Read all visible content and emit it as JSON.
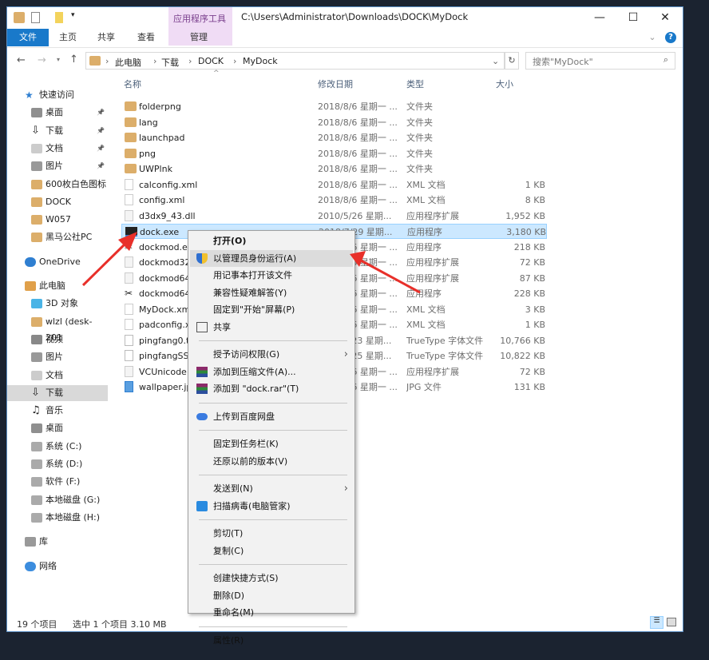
{
  "window": {
    "title": "C:\\Users\\Administrator\\Downloads\\DOCK\\MyDock",
    "context_tab": "应用程序工具",
    "minimize": "—",
    "maximize": "☐",
    "close": "✕"
  },
  "ribbon": {
    "tabs": [
      "文件",
      "主页",
      "共享",
      "查看",
      "管理"
    ],
    "expand": "⌄",
    "help": "?"
  },
  "address": {
    "crumbs": [
      "此电脑",
      "下载",
      "DOCK",
      "MyDock"
    ],
    "search_placeholder": "搜索\"MyDock\"",
    "refresh": "↻"
  },
  "columns": {
    "name": "名称",
    "date": "修改日期",
    "type": "类型",
    "size": "大小"
  },
  "sidebar": [
    {
      "label": "快速访问",
      "icon": "star",
      "indent": 0
    },
    {
      "label": "桌面",
      "icon": "desktop",
      "indent": 1,
      "pin": true
    },
    {
      "label": "下载",
      "icon": "download",
      "indent": 1,
      "pin": true
    },
    {
      "label": "文档",
      "icon": "document",
      "indent": 1,
      "pin": true
    },
    {
      "label": "图片",
      "icon": "pictures",
      "indent": 1,
      "pin": true
    },
    {
      "label": "600枚白色图标",
      "icon": "folder",
      "indent": 1
    },
    {
      "label": "DOCK",
      "icon": "folder",
      "indent": 1
    },
    {
      "label": "W057",
      "icon": "folder",
      "indent": 1
    },
    {
      "label": "黑马公社PC",
      "icon": "folder",
      "indent": 1
    },
    {
      "label": "OneDrive",
      "icon": "cloud",
      "indent": 0,
      "gap": true
    },
    {
      "label": "此电脑",
      "icon": "computer",
      "indent": 0,
      "gap": true
    },
    {
      "label": "3D 对象",
      "icon": "cube",
      "indent": 1
    },
    {
      "label": "wlzl (desk-201",
      "icon": "folder",
      "indent": 1
    },
    {
      "label": "视频",
      "icon": "video",
      "indent": 1
    },
    {
      "label": "图片",
      "icon": "pictures",
      "indent": 1
    },
    {
      "label": "文档",
      "icon": "document",
      "indent": 1
    },
    {
      "label": "下载",
      "icon": "download",
      "indent": 1,
      "selected": true
    },
    {
      "label": "音乐",
      "icon": "music",
      "indent": 1
    },
    {
      "label": "桌面",
      "icon": "desktop",
      "indent": 1
    },
    {
      "label": "系统 (C:)",
      "icon": "drive",
      "indent": 1
    },
    {
      "label": "系统 (D:)",
      "icon": "drive",
      "indent": 1
    },
    {
      "label": "软件 (F:)",
      "icon": "drive",
      "indent": 1
    },
    {
      "label": "本地磁盘 (G:)",
      "icon": "drive",
      "indent": 1
    },
    {
      "label": "本地磁盘 (H:)",
      "icon": "drive",
      "indent": 1
    },
    {
      "label": "库",
      "icon": "library",
      "indent": 0,
      "gap": true
    },
    {
      "label": "网络",
      "icon": "network",
      "indent": 0,
      "gap": true
    }
  ],
  "files": [
    {
      "name": "folderpng",
      "date": "2018/8/6 星期一 ...",
      "type": "文件夹",
      "size": "",
      "icon": "folder"
    },
    {
      "name": "lang",
      "date": "2018/8/6 星期一 ...",
      "type": "文件夹",
      "size": "",
      "icon": "folder"
    },
    {
      "name": "launchpad",
      "date": "2018/8/6 星期一 ...",
      "type": "文件夹",
      "size": "",
      "icon": "folder"
    },
    {
      "name": "png",
      "date": "2018/8/6 星期一 ...",
      "type": "文件夹",
      "size": "",
      "icon": "folder"
    },
    {
      "name": "UWPlnk",
      "date": "2018/8/6 星期一 ...",
      "type": "文件夹",
      "size": "",
      "icon": "folder"
    },
    {
      "name": "calconfig.xml",
      "date": "2018/8/6 星期一 ...",
      "type": "XML 文档",
      "size": "1 KB",
      "icon": "file"
    },
    {
      "name": "config.xml",
      "date": "2018/8/6 星期一 ...",
      "type": "XML 文档",
      "size": "8 KB",
      "icon": "file"
    },
    {
      "name": "d3dx9_43.dll",
      "date": "2010/5/26 星期...",
      "type": "应用程序扩展",
      "size": "1,952 KB",
      "icon": "dll"
    },
    {
      "name": "dock.exe",
      "date": "2018/7/29 星期...",
      "type": "应用程序",
      "size": "3,180 KB",
      "icon": "exe",
      "selected": true
    },
    {
      "name": "dockmod.exe",
      "date": "2018/8/6 星期一 ...",
      "type": "应用程序",
      "size": "218 KB",
      "icon": "tool"
    },
    {
      "name": "dockmod32.dll",
      "date": "2018/8/6 星期一 ...",
      "type": "应用程序扩展",
      "size": "72 KB",
      "icon": "dll"
    },
    {
      "name": "dockmod64.dll",
      "date": "2018/8/6 星期一 ...",
      "type": "应用程序扩展",
      "size": "87 KB",
      "icon": "dll"
    },
    {
      "name": "dockmod64.exe",
      "date": "2018/8/6 星期一 ...",
      "type": "应用程序",
      "size": "228 KB",
      "icon": "tool"
    },
    {
      "name": "MyDock.xml",
      "date": "2018/8/6 星期一 ...",
      "type": "XML 文档",
      "size": "3 KB",
      "icon": "file"
    },
    {
      "name": "padconfig.xml",
      "date": "2018/8/6 星期一 ...",
      "type": "XML 文档",
      "size": "1 KB",
      "icon": "file"
    },
    {
      "name": "pingfang0.ttf",
      "date": "2018/7/23 星期...",
      "type": "TrueType 字体文件",
      "size": "10,766 KB",
      "icon": "font"
    },
    {
      "name": "pingfangSS.ttf",
      "date": "2018/7/25 星期...",
      "type": "TrueType 字体文件",
      "size": "10,822 KB",
      "icon": "font"
    },
    {
      "name": "VCUnicode.dll",
      "date": "2018/8/6 星期一 ...",
      "type": "应用程序扩展",
      "size": "72 KB",
      "icon": "dll"
    },
    {
      "name": "wallpaper.jpg",
      "date": "2018/8/6 星期一 ...",
      "type": "JPG 文件",
      "size": "131 KB",
      "icon": "image"
    }
  ],
  "context_menu": [
    {
      "label": "打开(O)",
      "bold": true
    },
    {
      "label": "以管理员身份运行(A)",
      "icon": "uac-shield",
      "highlight": true
    },
    {
      "label": "用记事本打开该文件"
    },
    {
      "label": "兼容性疑难解答(Y)"
    },
    {
      "label": "固定到\"开始\"屏幕(P)"
    },
    {
      "label": "共享",
      "icon": "share"
    },
    {
      "sep": true
    },
    {
      "label": "授予访问权限(G)",
      "submenu": true
    },
    {
      "label": "添加到压缩文件(A)...",
      "icon": "winrar"
    },
    {
      "label": "添加到 \"dock.rar\"(T)",
      "icon": "winrar"
    },
    {
      "sep": true
    },
    {
      "label": "上传到百度网盘",
      "icon": "baidu-cloud"
    },
    {
      "sep": true
    },
    {
      "label": "固定到任务栏(K)"
    },
    {
      "label": "还原以前的版本(V)"
    },
    {
      "sep": true
    },
    {
      "label": "发送到(N)",
      "submenu": true
    },
    {
      "label": "扫描病毒(电脑管家)",
      "icon": "tencent-shield"
    },
    {
      "sep": true
    },
    {
      "label": "剪切(T)"
    },
    {
      "label": "复制(C)"
    },
    {
      "sep": true
    },
    {
      "label": "创建快捷方式(S)"
    },
    {
      "label": "删除(D)"
    },
    {
      "label": "重命名(M)"
    },
    {
      "sep": true
    },
    {
      "label": "属性(R)"
    }
  ],
  "status": {
    "count": "19 个项目",
    "selection": "选中 1 个项目  3.10 MB"
  },
  "colors": {
    "accent": "#1979ca",
    "selection": "#cce8ff",
    "folder": "#dcae6a",
    "arrow": "#e8302a",
    "background": "#1b2330"
  }
}
